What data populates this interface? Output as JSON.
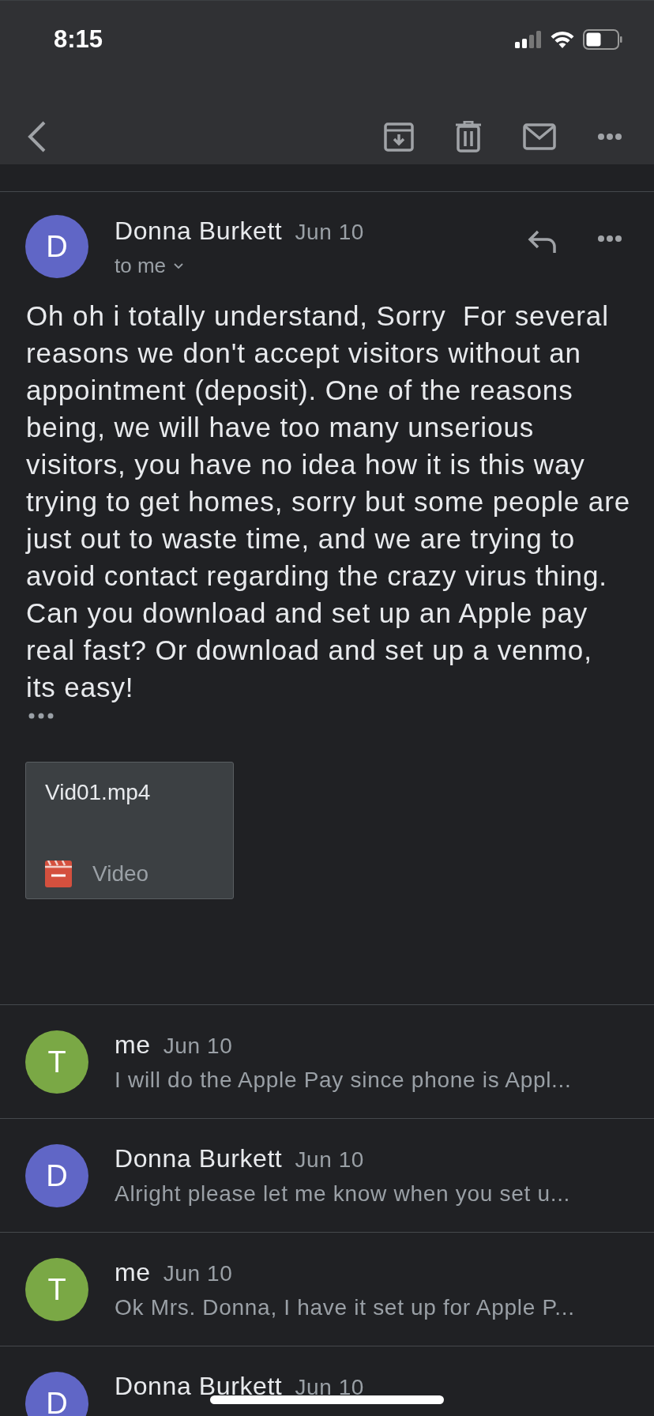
{
  "status_bar": {
    "time": "8:15"
  },
  "open_message": {
    "sender": "Donna Burkett",
    "initial": "D",
    "date": "Jun 10",
    "recipient": "to me",
    "body": "Oh oh i totally understand, Sorry  For several reasons we don't accept visitors without an appointment (deposit). One of the reasons being, we will have too many unserious visitors, you have no idea how it is this way trying to get homes, sorry but some people are just out to waste time, and we are trying to avoid contact regarding the crazy virus thing. Can you download and set up an Apple pay real fast? Or download and set up a venmo,  its easy!",
    "attachment": {
      "name": "Vid01.mp4",
      "type": "Video"
    }
  },
  "thread": [
    {
      "sender": "me",
      "initial": "T",
      "color": "#7aa845",
      "date": "Jun 10",
      "preview": "I will do the Apple Pay since phone is Appl..."
    },
    {
      "sender": "Donna Burkett",
      "initial": "D",
      "color": "#6066c6",
      "date": "Jun 10",
      "preview": "Alright please let me know when you set u..."
    },
    {
      "sender": "me",
      "initial": "T",
      "color": "#7aa845",
      "date": "Jun 10",
      "preview": "Ok Mrs. Donna, I have it set up for Apple P..."
    },
    {
      "sender": "Donna Burkett",
      "initial": "D",
      "color": "#6066c6",
      "date": "Jun 10"
    }
  ]
}
